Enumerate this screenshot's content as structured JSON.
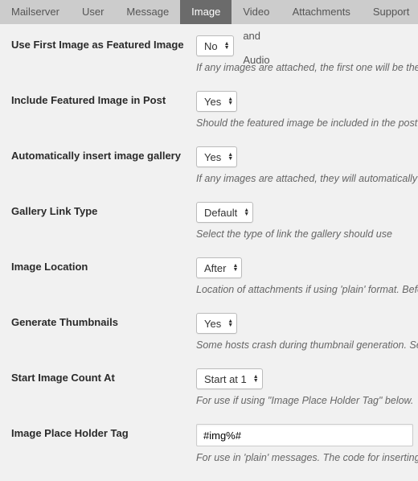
{
  "tabs": {
    "mailserver": "Mailserver",
    "user": "User",
    "message": "Message",
    "image": "Image",
    "video_audio": "Video and Audio",
    "attachments": "Attachments",
    "support": "Support"
  },
  "rows": {
    "first_image": {
      "label": "Use First Image as Featured Image",
      "value": "No",
      "desc": "If any images are attached, the first one will be the featured image for the post"
    },
    "include_featured": {
      "label": "Include Featured Image in Post",
      "value": "Yes",
      "desc": "Should the featured image be included in the post"
    },
    "auto_gallery": {
      "label": "Automatically insert image gallery",
      "value": "Yes",
      "desc": "If any images are attached, they will automatically be inserted as a gallery"
    },
    "gallery_link": {
      "label": "Gallery Link Type",
      "value": "Default",
      "desc": "Select the type of link the gallery should use"
    },
    "image_location": {
      "label": "Image Location",
      "value": "After",
      "desc": "Location of attachments if using 'plain' format. Before or After content."
    },
    "gen_thumbs": {
      "label": "Generate Thumbnails",
      "value": "Yes",
      "desc": "Some hosts crash during thumbnail generation. Set this to no if you have problems."
    },
    "start_count": {
      "label": "Start Image Count At",
      "value": "Start at 1",
      "desc": "For use if using \"Image Place Holder Tag\" below."
    },
    "placeholder_tag": {
      "label": "Image Place Holder Tag",
      "value": "#img%#",
      "desc": "For use in 'plain' messages. The code for inserting an image. The % will be replaced with the image number. Use %1 for the first image to show. See also \"Start Image Count At\""
    }
  }
}
